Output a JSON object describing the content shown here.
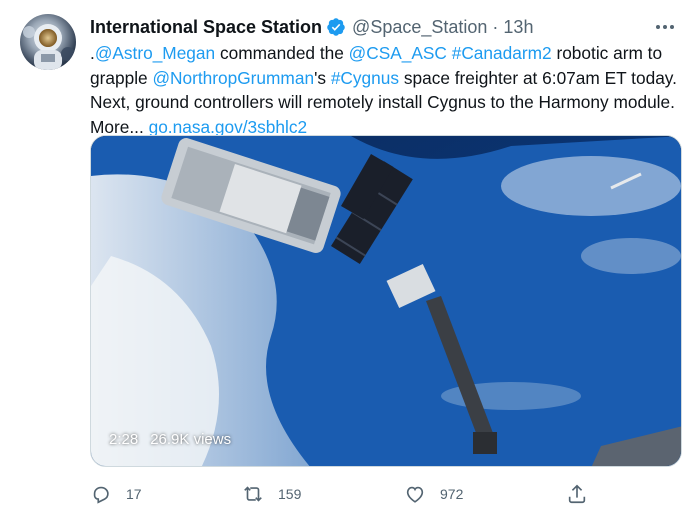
{
  "tweet": {
    "display_name": "International Space Station",
    "handle": "@Space_Station",
    "separator": "·",
    "time": "13h",
    "text": {
      "part1": ".",
      "mention1": "@Astro_Megan",
      "part2": " commanded the ",
      "mention2": "@CSA_ASC",
      "part3": " ",
      "hashtag1": "#Canadarm2",
      "part4": " robotic arm to grapple ",
      "mention3": "@NorthropGrumman",
      "part5": "'s ",
      "hashtag2": "#Cygnus",
      "part6": " space freighter at 6:07am ET today. Next, ground controllers will remotely install Cygnus to the Harmony module. More... ",
      "link": "go.nasa.gov/3sbhlc2"
    },
    "media": {
      "duration": "2:28",
      "views": "26.9K views"
    },
    "actions": {
      "reply_count": "17",
      "retweet_count": "159",
      "like_count": "972"
    },
    "colors": {
      "link": "#1d9bf0",
      "secondary": "#536471",
      "verified": "#1d9bf0"
    },
    "icons": [
      "verified-badge-icon",
      "more-icon",
      "reply-icon",
      "retweet-icon",
      "like-icon",
      "share-icon"
    ]
  }
}
